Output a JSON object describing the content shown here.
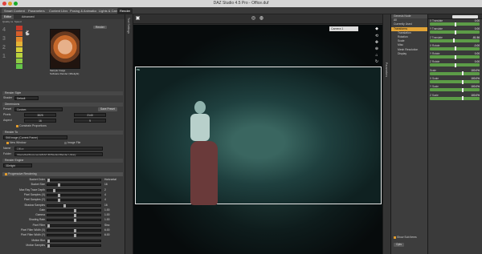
{
  "window": {
    "title": "DAZ Studio 4.5 Pro - Office.duf"
  },
  "top_tabs": [
    "Smart Content",
    "Parameters",
    "Content Library",
    "Posing & Animation",
    "Lights & Cameras",
    "Render"
  ],
  "top_links": {
    "feedback": "Feedback",
    "account": "My Account",
    "search": "Search"
  },
  "render_settings": {
    "tabs": [
      "Editor",
      "Advanced"
    ],
    "quality_label": "Quality vs. Speed",
    "quality_levels": [
      "4",
      "3",
      "2",
      "1"
    ],
    "preset_caption": "Sample Image",
    "preset_subcaption": "Software Render (3Delight)",
    "render_style_section": "Render Style",
    "render_style_label": "Shader",
    "render_style_value": "Default",
    "dimensions_section": "Dimensions",
    "preset_label": "Preset",
    "preset_value": "Custom",
    "save_preset_btn": "Save Preset",
    "pixels_label": "Pixels",
    "pixels_w": "3825",
    "pixels_h": "2140",
    "aspect_label": "Aspect",
    "aspect_w": "16",
    "aspect_h": "9",
    "constrain_label": "Constrain Proportions",
    "render_to_section": "Render To",
    "render_to_value": "Still Image (Current Frame)",
    "new_window_label": "New Window",
    "image_file_label": "Image File",
    "name_label": "Name",
    "name_value": "Office",
    "folder_label": "Folder",
    "folder_value": "/Users/daz/Documents/DAZ 3D/Studio4/Render Library",
    "render_engine_section": "Render Engine",
    "render_engine_value": "3Delight",
    "progressive_label": "Progressive Rendering",
    "sliders": [
      {
        "label": "Bucket Order",
        "value": "Horizontal"
      },
      {
        "label": "Bucket Size",
        "value": "16"
      },
      {
        "label": "Max Ray Trace Depth",
        "value": "2"
      },
      {
        "label": "Pixel Samples (X)",
        "value": "4"
      },
      {
        "label": "Pixel Samples (Y)",
        "value": "4"
      },
      {
        "label": "Shadow Samples",
        "value": "16"
      },
      {
        "label": "Gain",
        "value": "1.00"
      },
      {
        "label": "Gamma",
        "value": "1.00"
      },
      {
        "label": "Shading Rate",
        "value": "1.00"
      },
      {
        "label": "Pixel Filter",
        "value": "Sinc"
      },
      {
        "label": "Pixel Filter Width (X)",
        "value": "6.00"
      },
      {
        "label": "Pixel Filter Width (Y)",
        "value": "6.00"
      },
      {
        "label": "Motion Blur",
        "value": ""
      },
      {
        "label": "Motion Samples",
        "value": ""
      }
    ]
  },
  "viewport": {
    "camera": "Camera 1",
    "label": "PE",
    "view": "Perspective View"
  },
  "parameters": {
    "tree": [
      "All",
      "Currently Used",
      "Transforms",
      "Translation",
      "Rotation",
      "Scale",
      "Misc",
      "Mesh Resolution",
      "Display"
    ],
    "selected_index": 2,
    "header": "Genesis Node",
    "props": [
      {
        "label": "X Translate",
        "value": "0.00"
      },
      {
        "label": "Y Translate",
        "value": "0.00"
      },
      {
        "label": "Z Translate",
        "value": "-81.56"
      },
      {
        "label": "X Rotate",
        "value": "-0.00"
      },
      {
        "label": "Y Rotate",
        "value": "0.00"
      },
      {
        "label": "Z Rotate",
        "value": "0.00"
      },
      {
        "label": "Scale",
        "value": "100.0%"
      },
      {
        "label": "X Scale",
        "value": "100.0%"
      },
      {
        "label": "Y Scale",
        "value": "100.0%"
      },
      {
        "label": "Z Scale",
        "value": "100.0%"
      }
    ],
    "show_sub_items": "Show Sub Items",
    "footer_btn": "Opts"
  },
  "colors": {
    "accent": "#e2a437",
    "slider_green": "#5c9c47"
  },
  "icons": [
    "window-close-icon",
    "camera-icon",
    "render-icon",
    "rotate-icon",
    "pan-icon",
    "zoom-icon"
  ]
}
